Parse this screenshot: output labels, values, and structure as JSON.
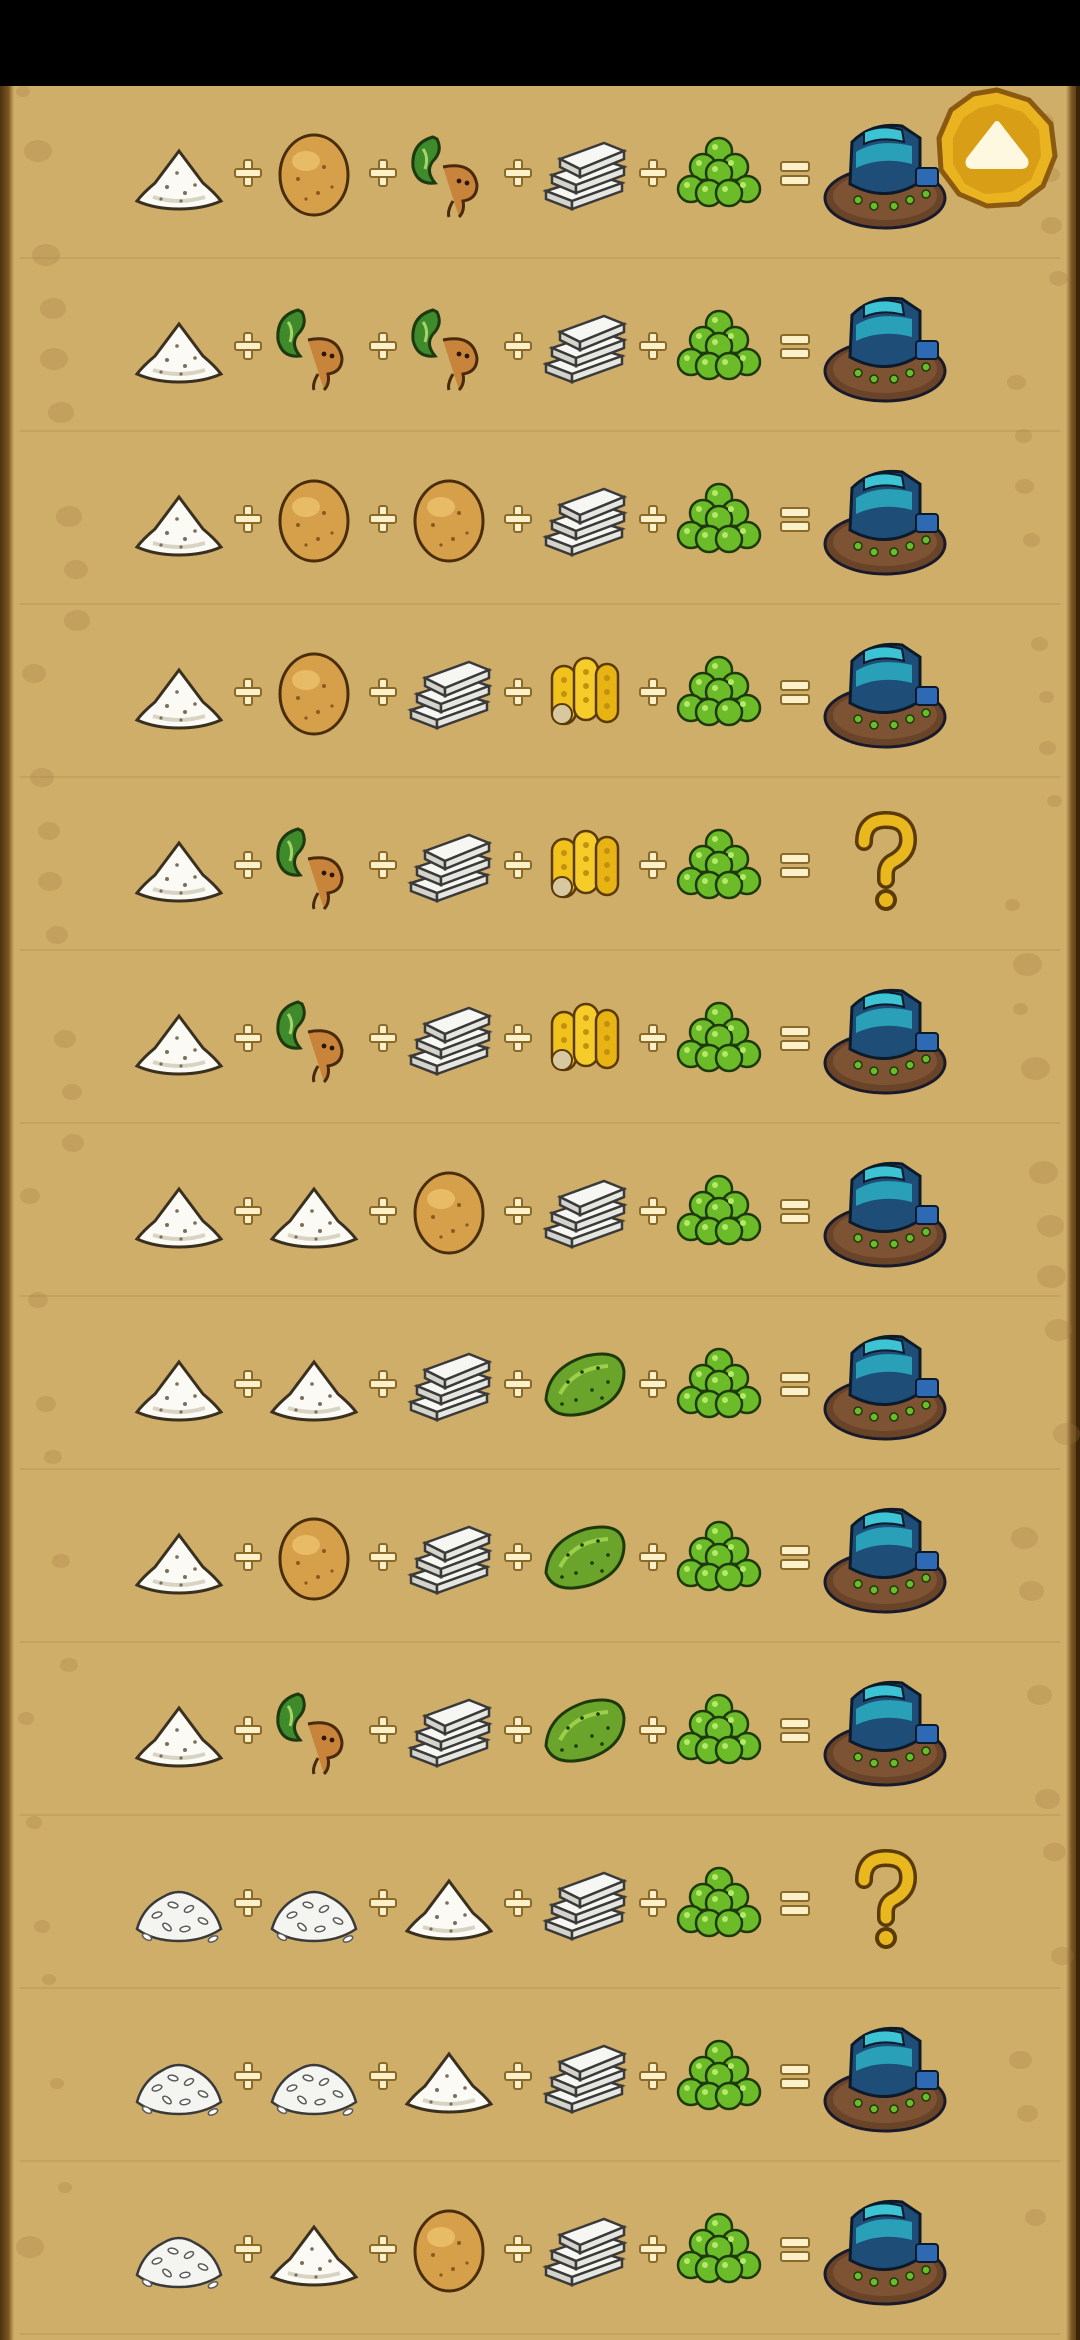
{
  "screen": {
    "title": ""
  },
  "colors": {
    "parchment": "#cfae6a",
    "frame": "#4a3210",
    "plus_sign": "#fbf0c8",
    "question_mark": "#e8b81e",
    "scroll_button": "#e9b420"
  },
  "scroll_top_button": {
    "icon": "up-arrow-icon"
  },
  "recipes": [
    {
      "ingredients": [
        "flour",
        "potato",
        "mandrake-root",
        "sugar-cubes",
        "green-berries"
      ],
      "result": "blue-machine"
    },
    {
      "ingredients": [
        "flour",
        "mandrake-root",
        "mandrake-root",
        "sugar-cubes",
        "green-berries"
      ],
      "result": "blue-machine"
    },
    {
      "ingredients": [
        "flour",
        "potato",
        "potato",
        "sugar-cubes",
        "green-berries"
      ],
      "result": "blue-machine"
    },
    {
      "ingredients": [
        "flour",
        "potato",
        "sugar-cubes",
        "corn",
        "green-berries"
      ],
      "result": "blue-machine"
    },
    {
      "ingredients": [
        "flour",
        "mandrake-root",
        "sugar-cubes",
        "corn",
        "green-berries"
      ],
      "result": "unknown"
    },
    {
      "ingredients": [
        "flour",
        "mandrake-root",
        "sugar-cubes",
        "corn",
        "green-berries"
      ],
      "result": "blue-machine"
    },
    {
      "ingredients": [
        "flour",
        "flour",
        "potato",
        "sugar-cubes",
        "green-berries"
      ],
      "result": "blue-machine"
    },
    {
      "ingredients": [
        "flour",
        "flour",
        "sugar-cubes",
        "cactus-pear",
        "green-berries"
      ],
      "result": "blue-machine"
    },
    {
      "ingredients": [
        "flour",
        "potato",
        "sugar-cubes",
        "cactus-pear",
        "green-berries"
      ],
      "result": "blue-machine"
    },
    {
      "ingredients": [
        "flour",
        "mandrake-root",
        "sugar-cubes",
        "cactus-pear",
        "green-berries"
      ],
      "result": "blue-machine"
    },
    {
      "ingredients": [
        "rice",
        "rice",
        "flour",
        "sugar-cubes",
        "green-berries"
      ],
      "result": "unknown"
    },
    {
      "ingredients": [
        "rice",
        "rice",
        "flour",
        "sugar-cubes",
        "green-berries"
      ],
      "result": "blue-machine"
    },
    {
      "ingredients": [
        "rice",
        "flour",
        "potato",
        "sugar-cubes",
        "green-berries"
      ],
      "result": "blue-machine"
    }
  ]
}
